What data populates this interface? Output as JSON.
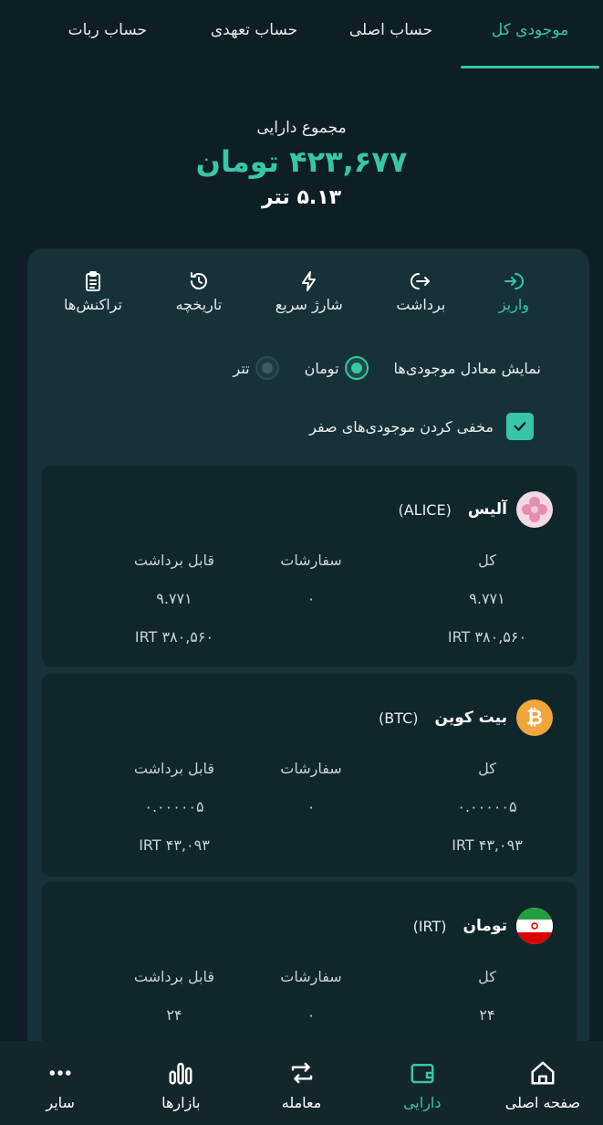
{
  "tabs": [
    {
      "label": "موجودی کل",
      "active": true
    },
    {
      "label": "حساب اصلی"
    },
    {
      "label": "حساب تعهدی"
    },
    {
      "label": "حساب ربات"
    }
  ],
  "summary": {
    "label": "مجموع دارایی",
    "toman": "۴۲۳,۶۷۷ تومان",
    "tether": "۵.۱۳ تتر"
  },
  "actions": {
    "deposit": "واریز",
    "withdraw": "برداشت",
    "quick_charge": "شارژ سریع",
    "history": "تاریخچه",
    "transactions": "تراکنش‌ها"
  },
  "display": {
    "label": "نمایش معادل موجودی‌ها",
    "toman": "تومان",
    "tether": "تتر",
    "selected": "toman"
  },
  "hide_zero": {
    "label": "مخفی کردن موجودی‌های صفر",
    "checked": true
  },
  "columns": {
    "total": "کل",
    "orders": "سفارشات",
    "withdrawable": "قابل برداشت"
  },
  "assets": [
    {
      "name": "آلیس",
      "symbol": "(ALICE)",
      "icon": "alice-flower-icon",
      "total": "۹.۷۷۱",
      "orders": "۰",
      "withdrawable": "۹.۷۷۱",
      "total_irt": "۳۸۰,۵۶۰ IRT",
      "withdrawable_irt": "۳۸۰,۵۶۰ IRT"
    },
    {
      "name": "بیت کوین",
      "symbol": "(BTC)",
      "icon": "bitcoin-icon",
      "total": "۰.۰۰۰۰۰۵",
      "orders": "۰",
      "withdrawable": "۰.۰۰۰۰۰۵",
      "total_irt": "۴۳,۰۹۳ IRT",
      "withdrawable_irt": "۴۳,۰۹۳ IRT"
    },
    {
      "name": "تومان",
      "symbol": "(IRT)",
      "icon": "iran-flag-icon",
      "total": "۲۴",
      "orders": "۰",
      "withdrawable": "۲۴"
    }
  ],
  "nav": {
    "home": "صفحه اصلی",
    "assets": "دارایی",
    "trade": "معامله",
    "markets": "بازارها",
    "more": "سایر",
    "active": "assets"
  },
  "colors": {
    "accent": "#38c6a4",
    "background": "#0d1f24",
    "panel": "#163238",
    "card": "#0f262b",
    "bitcoin": "#f0a63a"
  }
}
